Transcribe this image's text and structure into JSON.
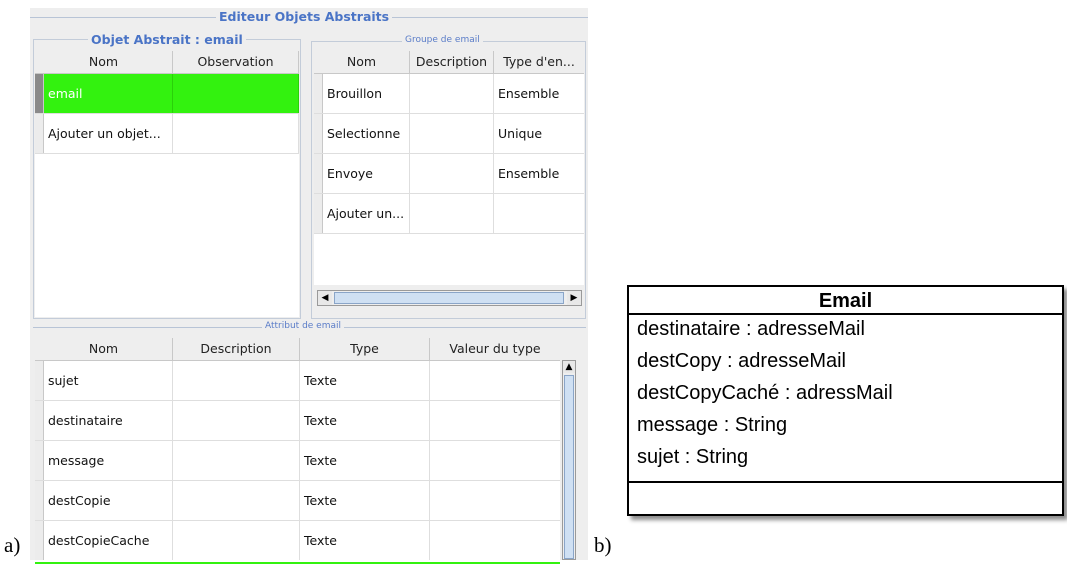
{
  "captions": {
    "a": "a)",
    "b": "b)"
  },
  "editor": {
    "title": "Editeur Objets Abstraits",
    "objects_panel": {
      "title": "Objet Abstrait : email",
      "columns": [
        "Nom",
        "Observation"
      ],
      "rows": [
        {
          "nom": "email",
          "observation": "",
          "selected": true
        },
        {
          "nom": "Ajouter un objet...",
          "observation": "",
          "selected": false
        }
      ]
    },
    "groups_panel": {
      "title": "Groupe de email",
      "columns": [
        "Nom",
        "Description",
        "Type d'en..."
      ],
      "rows": [
        {
          "nom": "Brouillon",
          "description": "",
          "type": "Ensemble"
        },
        {
          "nom": "Selectionne",
          "description": "",
          "type": "Unique"
        },
        {
          "nom": "Envoye",
          "description": "",
          "type": "Ensemble"
        },
        {
          "nom": "Ajouter un...",
          "description": "",
          "type": ""
        }
      ]
    },
    "attributes_panel": {
      "title": "Attribut de email",
      "columns": [
        "Nom",
        "Description",
        "Type",
        "Valeur du type"
      ],
      "rows": [
        {
          "nom": "sujet",
          "description": "",
          "type": "Texte",
          "valeur": ""
        },
        {
          "nom": "destinataire",
          "description": "",
          "type": "Texte",
          "valeur": ""
        },
        {
          "nom": "message",
          "description": "",
          "type": "Texte",
          "valeur": ""
        },
        {
          "nom": "destCopie",
          "description": "",
          "type": "Texte",
          "valeur": ""
        },
        {
          "nom": "destCopieCache",
          "description": "",
          "type": "Texte",
          "valeur": ""
        }
      ]
    },
    "colors": {
      "selection": "#33f20f",
      "title": "#4a74c6"
    }
  },
  "uml_class": {
    "name": "Email",
    "attributes": [
      "destinataire : adresseMail",
      "destCopy : adresseMail",
      "destCopyCaché : adressMail",
      "message : String",
      "sujet : String"
    ]
  }
}
